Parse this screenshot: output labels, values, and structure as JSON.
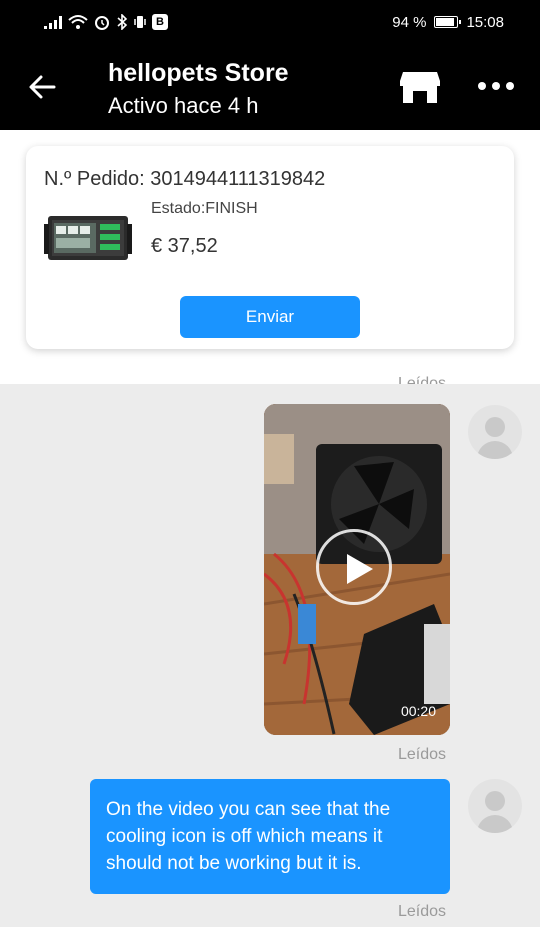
{
  "statusbar": {
    "battery": "94 %",
    "time": "15:08",
    "badge": "B"
  },
  "header": {
    "title": "hellopets Store",
    "subtitle": "Activo hace 4 h"
  },
  "order": {
    "number_label": "N.º Pedido: 3014944111319842",
    "status": "Estado:FINISH",
    "price": "€ 37,52",
    "send_label": "Enviar"
  },
  "messages": {
    "read_label_cut": "Leídos",
    "video_duration": "00:20",
    "video_read": "Leídos",
    "text": "On the video you can see that the cooling icon is off which means it should not be working but it is.",
    "text_read": "Leídos"
  },
  "colors": {
    "accent": "#1a94ff",
    "header_bg": "#000000",
    "chat_bg": "#ececec"
  }
}
